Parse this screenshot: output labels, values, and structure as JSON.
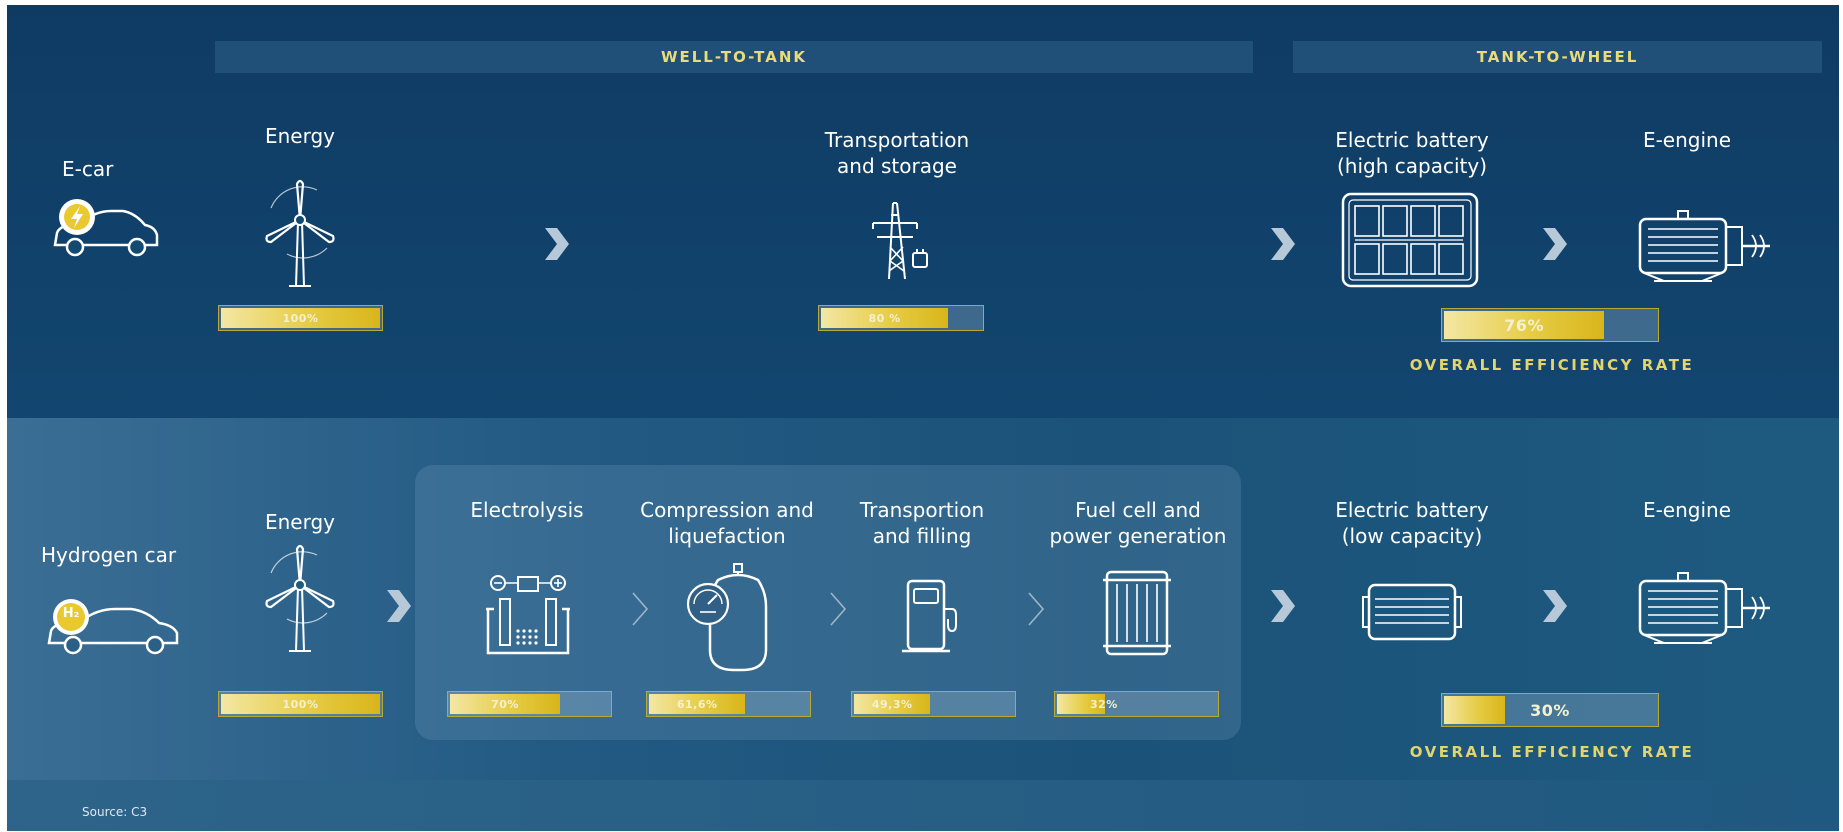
{
  "headers": {
    "well_to_tank": "WELL-TO-TANK",
    "tank_to_wheel": "TANK-TO-WHEEL"
  },
  "ecar": {
    "label": "E-car",
    "energy": {
      "label": "Energy",
      "percent_text": "100%",
      "value": 100
    },
    "transport": {
      "label_line1": "Transportation",
      "label_line2": "and storage",
      "percent_text": "80 %",
      "value": 80
    },
    "battery": {
      "label_line1": "Electric battery",
      "label_line2": "(high capacity)"
    },
    "engine": {
      "label": "E-engine"
    },
    "overall": {
      "percent_text": "76%",
      "value": 76,
      "label": "OVERALL EFFICIENCY RATE"
    }
  },
  "hcar": {
    "label": "Hydrogen car",
    "badge": "H₂",
    "energy": {
      "label": "Energy",
      "percent_text": "100%",
      "value": 100
    },
    "electrolysis": {
      "label": "Electrolysis",
      "percent_text": "70%",
      "value": 70
    },
    "compression": {
      "label_line1": "Compression and",
      "label_line2": "liquefaction",
      "percent_text": "61,6%",
      "value": 61.6
    },
    "transport": {
      "label_line1": "Transportion",
      "label_line2": "and filling",
      "percent_text": "49,3%",
      "value": 49.3
    },
    "fuelcell": {
      "label_line1": "Fuel cell and",
      "label_line2": "power generation",
      "percent_text": "32%",
      "value": 32
    },
    "battery": {
      "label_line1": "Electric battery",
      "label_line2": "(low capacity)"
    },
    "engine": {
      "label": "E-engine"
    },
    "overall": {
      "percent_text": "30%",
      "value": 30,
      "label": "OVERALL EFFICIENCY RATE"
    }
  },
  "source": "Source: C3",
  "colors": {
    "accent": "#e3d46c",
    "bar_fill": "#e6cc45",
    "background": "#134a72"
  }
}
